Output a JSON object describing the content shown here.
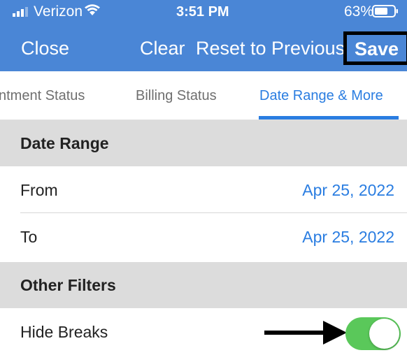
{
  "status_bar": {
    "carrier": "Verizon",
    "time": "3:51 PM",
    "battery": "63%"
  },
  "nav": {
    "close_label": "Close",
    "clear_label": "Clear",
    "reset_label": "Reset to Previous",
    "save_label": "Save"
  },
  "tabs": [
    {
      "label": "ntment Status",
      "selected": false
    },
    {
      "label": "Billing Status",
      "selected": false
    },
    {
      "label": "Date Range & More",
      "selected": true
    }
  ],
  "date_range": {
    "header": "Date Range",
    "rows": [
      {
        "label": "From",
        "value": "Apr 25, 2022"
      },
      {
        "label": "To",
        "value": "Apr 25, 2022"
      }
    ]
  },
  "other_filters": {
    "header": "Other Filters",
    "hide_breaks": {
      "label": "Hide Breaks",
      "enabled": true
    }
  },
  "colors": {
    "header_blue": "#4a86d6",
    "accent_blue": "#2a7de1",
    "toggle_on": "#5ac85a",
    "section_gray": "#dcdcdc"
  }
}
